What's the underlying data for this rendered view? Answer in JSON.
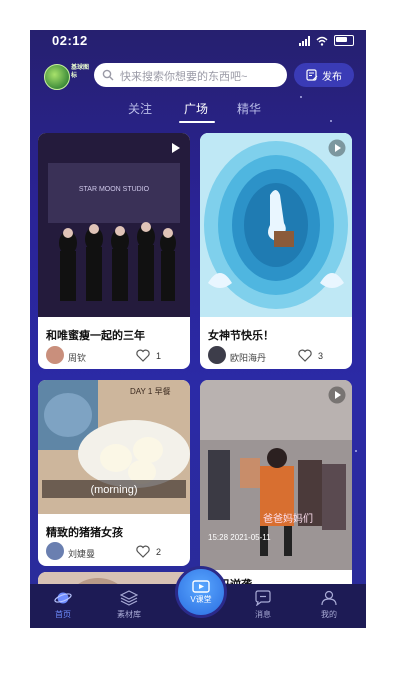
{
  "status": {
    "time": "02:12"
  },
  "header": {
    "logo_text": "基球图标",
    "search_placeholder": "快来搜索你想要的东西吧~",
    "publish_label": "发布"
  },
  "tabs": [
    {
      "label": "关注",
      "active": false
    },
    {
      "label": "广场",
      "active": true
    },
    {
      "label": "精华",
      "active": false
    }
  ],
  "cards": [
    {
      "title": "和唯蜜瘦一起的三年",
      "author": "周钦",
      "likes": "1",
      "image_text": "STAR MOON STUDIO",
      "accent": "#2a1f46"
    },
    {
      "title": "女神节快乐！",
      "author": "欧阳海丹",
      "likes": "3",
      "image_text": "",
      "accent": "#5fc7e8"
    },
    {
      "title": "精致的猪猪女孩",
      "author": "刘婕曼",
      "likes": "2",
      "image_text": "(morning)",
      "image_subtext": "DAY 1 早餐",
      "accent": "#c8a98a"
    },
    {
      "title": "辣妈逆袭",
      "author": "",
      "likes": "",
      "image_text": "爸爸妈妈们",
      "image_subtext": "15:28  2021-05-11",
      "accent": "#8a5b57"
    },
    {
      "title": "",
      "author": "",
      "likes": "",
      "image_text": "",
      "accent": "#d7c2b4"
    }
  ],
  "tabbar": {
    "items": [
      {
        "label": "首页",
        "icon": "planet-icon",
        "active": true
      },
      {
        "label": "素材库",
        "icon": "layers-icon",
        "active": false
      },
      {
        "label": "V课堂",
        "icon": "play-screen-icon",
        "active": false
      },
      {
        "label": "消息",
        "icon": "chat-icon",
        "active": false
      },
      {
        "label": "我的",
        "icon": "user-icon",
        "active": false
      }
    ]
  }
}
